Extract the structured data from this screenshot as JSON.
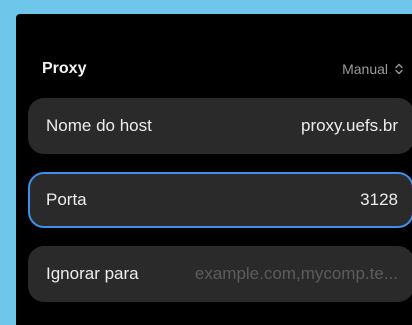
{
  "proxy": {
    "title": "Proxy",
    "mode": "Manual",
    "mode_icon": "updown-chevron-icon"
  },
  "fields": {
    "hostname": {
      "label": "Nome do host",
      "value": "proxy.uefs.br"
    },
    "port": {
      "label": "Porta",
      "value": "3128"
    },
    "bypass": {
      "label": "Ignorar para",
      "placeholder": "example.com,mycomp.te..."
    }
  },
  "colors": {
    "background": "#6ec6ea",
    "panel": "#000000",
    "row": "#2a2a2a",
    "focus_border": "#3f8ee8",
    "text": "#ededed",
    "secondary_text": "#9b9b9b",
    "placeholder": "#5c5c5c"
  }
}
